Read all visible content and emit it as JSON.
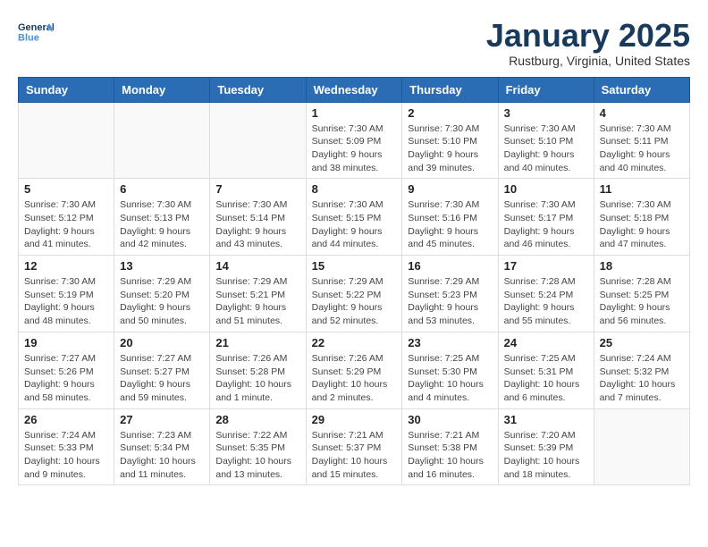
{
  "logo": {
    "general": "General",
    "blue": "Blue"
  },
  "title": "January 2025",
  "location": "Rustburg, Virginia, United States",
  "weekdays": [
    "Sunday",
    "Monday",
    "Tuesday",
    "Wednesday",
    "Thursday",
    "Friday",
    "Saturday"
  ],
  "weeks": [
    [
      {
        "day": "",
        "info": ""
      },
      {
        "day": "",
        "info": ""
      },
      {
        "day": "",
        "info": ""
      },
      {
        "day": "1",
        "info": "Sunrise: 7:30 AM\nSunset: 5:09 PM\nDaylight: 9 hours and 38 minutes."
      },
      {
        "day": "2",
        "info": "Sunrise: 7:30 AM\nSunset: 5:10 PM\nDaylight: 9 hours and 39 minutes."
      },
      {
        "day": "3",
        "info": "Sunrise: 7:30 AM\nSunset: 5:10 PM\nDaylight: 9 hours and 40 minutes."
      },
      {
        "day": "4",
        "info": "Sunrise: 7:30 AM\nSunset: 5:11 PM\nDaylight: 9 hours and 40 minutes."
      }
    ],
    [
      {
        "day": "5",
        "info": "Sunrise: 7:30 AM\nSunset: 5:12 PM\nDaylight: 9 hours and 41 minutes."
      },
      {
        "day": "6",
        "info": "Sunrise: 7:30 AM\nSunset: 5:13 PM\nDaylight: 9 hours and 42 minutes."
      },
      {
        "day": "7",
        "info": "Sunrise: 7:30 AM\nSunset: 5:14 PM\nDaylight: 9 hours and 43 minutes."
      },
      {
        "day": "8",
        "info": "Sunrise: 7:30 AM\nSunset: 5:15 PM\nDaylight: 9 hours and 44 minutes."
      },
      {
        "day": "9",
        "info": "Sunrise: 7:30 AM\nSunset: 5:16 PM\nDaylight: 9 hours and 45 minutes."
      },
      {
        "day": "10",
        "info": "Sunrise: 7:30 AM\nSunset: 5:17 PM\nDaylight: 9 hours and 46 minutes."
      },
      {
        "day": "11",
        "info": "Sunrise: 7:30 AM\nSunset: 5:18 PM\nDaylight: 9 hours and 47 minutes."
      }
    ],
    [
      {
        "day": "12",
        "info": "Sunrise: 7:30 AM\nSunset: 5:19 PM\nDaylight: 9 hours and 48 minutes."
      },
      {
        "day": "13",
        "info": "Sunrise: 7:29 AM\nSunset: 5:20 PM\nDaylight: 9 hours and 50 minutes."
      },
      {
        "day": "14",
        "info": "Sunrise: 7:29 AM\nSunset: 5:21 PM\nDaylight: 9 hours and 51 minutes."
      },
      {
        "day": "15",
        "info": "Sunrise: 7:29 AM\nSunset: 5:22 PM\nDaylight: 9 hours and 52 minutes."
      },
      {
        "day": "16",
        "info": "Sunrise: 7:29 AM\nSunset: 5:23 PM\nDaylight: 9 hours and 53 minutes."
      },
      {
        "day": "17",
        "info": "Sunrise: 7:28 AM\nSunset: 5:24 PM\nDaylight: 9 hours and 55 minutes."
      },
      {
        "day": "18",
        "info": "Sunrise: 7:28 AM\nSunset: 5:25 PM\nDaylight: 9 hours and 56 minutes."
      }
    ],
    [
      {
        "day": "19",
        "info": "Sunrise: 7:27 AM\nSunset: 5:26 PM\nDaylight: 9 hours and 58 minutes."
      },
      {
        "day": "20",
        "info": "Sunrise: 7:27 AM\nSunset: 5:27 PM\nDaylight: 9 hours and 59 minutes."
      },
      {
        "day": "21",
        "info": "Sunrise: 7:26 AM\nSunset: 5:28 PM\nDaylight: 10 hours and 1 minute."
      },
      {
        "day": "22",
        "info": "Sunrise: 7:26 AM\nSunset: 5:29 PM\nDaylight: 10 hours and 2 minutes."
      },
      {
        "day": "23",
        "info": "Sunrise: 7:25 AM\nSunset: 5:30 PM\nDaylight: 10 hours and 4 minutes."
      },
      {
        "day": "24",
        "info": "Sunrise: 7:25 AM\nSunset: 5:31 PM\nDaylight: 10 hours and 6 minutes."
      },
      {
        "day": "25",
        "info": "Sunrise: 7:24 AM\nSunset: 5:32 PM\nDaylight: 10 hours and 7 minutes."
      }
    ],
    [
      {
        "day": "26",
        "info": "Sunrise: 7:24 AM\nSunset: 5:33 PM\nDaylight: 10 hours and 9 minutes."
      },
      {
        "day": "27",
        "info": "Sunrise: 7:23 AM\nSunset: 5:34 PM\nDaylight: 10 hours and 11 minutes."
      },
      {
        "day": "28",
        "info": "Sunrise: 7:22 AM\nSunset: 5:35 PM\nDaylight: 10 hours and 13 minutes."
      },
      {
        "day": "29",
        "info": "Sunrise: 7:21 AM\nSunset: 5:37 PM\nDaylight: 10 hours and 15 minutes."
      },
      {
        "day": "30",
        "info": "Sunrise: 7:21 AM\nSunset: 5:38 PM\nDaylight: 10 hours and 16 minutes."
      },
      {
        "day": "31",
        "info": "Sunrise: 7:20 AM\nSunset: 5:39 PM\nDaylight: 10 hours and 18 minutes."
      },
      {
        "day": "",
        "info": ""
      }
    ]
  ]
}
